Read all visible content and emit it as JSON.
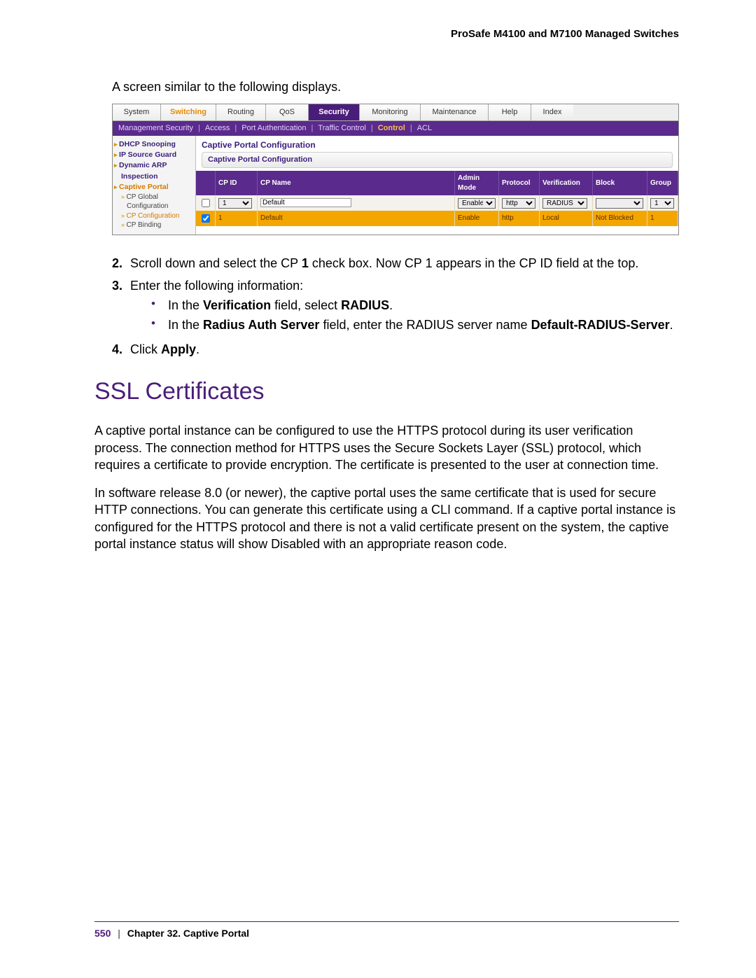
{
  "header": {
    "title": "ProSafe M4100 and M7100 Managed Switches"
  },
  "intro": "A screen similar to the following displays.",
  "screenshot": {
    "tabs": [
      "System",
      "Switching",
      "Routing",
      "QoS",
      "Security",
      "Monitoring",
      "Maintenance",
      "Help",
      "Index"
    ],
    "tab_active": "Security",
    "tab_orange": "Switching",
    "subtabs": [
      "Management Security",
      "Access",
      "Port Authentication",
      "Traffic Control",
      "Control",
      "ACL"
    ],
    "subtab_active": "Control",
    "sidebar": {
      "items": [
        "DHCP Snooping",
        "IP Source Guard",
        "Dynamic ARP Inspection",
        "Captive Portal"
      ],
      "selected": "Captive Portal",
      "subitems": [
        "CP Global Configuration",
        "CP Configuration",
        "CP Binding"
      ],
      "sub_selected": "CP Configuration"
    },
    "config_title": "Captive Portal Configuration",
    "config_subtitle": "Captive Portal Configuration",
    "columns": [
      "",
      "CP ID",
      "CP Name",
      "Admin Mode",
      "Protocol",
      "Verification",
      "Block",
      "Group"
    ],
    "input_row": {
      "cp_id": "1",
      "cp_name": "Default",
      "admin_mode": "Enable",
      "protocol": "http",
      "verification": "RADIUS",
      "block": "",
      "group": "1"
    },
    "data_row": {
      "cp_id": "1",
      "cp_name": "Default",
      "admin_mode": "Enable",
      "protocol": "http",
      "verification": "Local",
      "block": "Not Blocked",
      "group": "1"
    }
  },
  "steps": {
    "s2_a": "Scroll down and select the CP ",
    "s2_bold": "1",
    "s2_b": " check box. Now CP 1 appears in the CP ID field at the top.",
    "s3": "Enter the following information:",
    "s3_b1_a": "In the ",
    "s3_b1_bold1": "Verification",
    "s3_b1_b": " field, select ",
    "s3_b1_bold2": "RADIUS",
    "s3_b1_c": ".",
    "s3_b2_a": "In the ",
    "s3_b2_bold1": "Radius Auth Server",
    "s3_b2_b": " field, enter the RADIUS server name ",
    "s3_b2_bold2": "Default-RADIUS-Server",
    "s3_b2_c": ".",
    "s4_a": "Click ",
    "s4_bold": "Apply",
    "s4_b": "."
  },
  "section_heading": "SSL Certificates",
  "para1": "A captive portal instance can be configured to use the HTTPS protocol during its user verification process. The connection method for HTTPS uses the Secure Sockets Layer (SSL) protocol, which requires a certificate to provide encryption. The certificate is presented to the user at connection time.",
  "para2": "In software release 8.0 (or newer), the captive portal uses the same certificate that is used for secure HTTP connections. You can generate this certificate using a CLI command. If a captive portal instance is configured for the HTTPS protocol and there is not a valid certificate present on the system, the captive portal instance status will show Disabled with an appropriate reason code.",
  "footer": {
    "page": "550",
    "chapter": "Chapter 32.  Captive Portal"
  }
}
